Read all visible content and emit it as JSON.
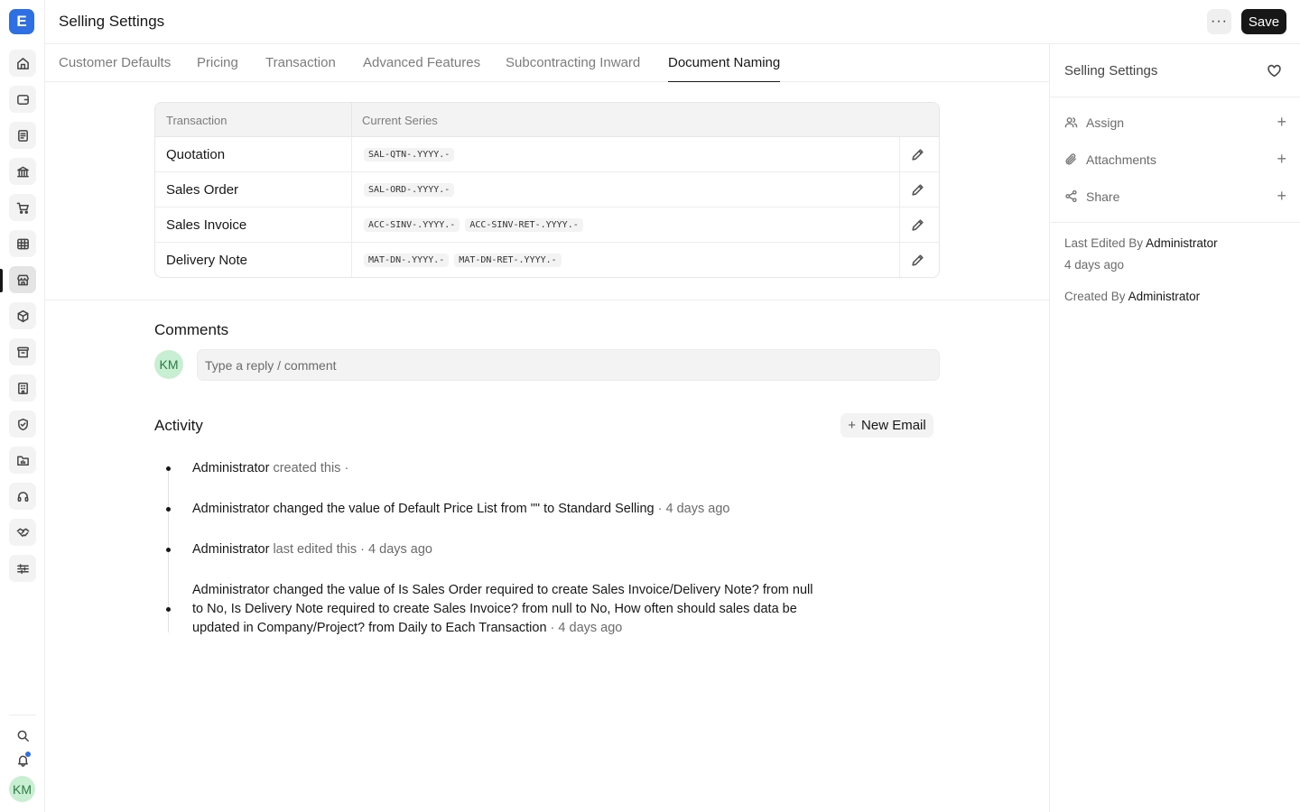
{
  "app": {
    "logo_letter": "E"
  },
  "header": {
    "title": "Selling Settings",
    "more_label": "···",
    "save_label": "Save"
  },
  "tabs": [
    {
      "label": "Customer Defaults"
    },
    {
      "label": "Pricing"
    },
    {
      "label": "Transaction"
    },
    {
      "label": "Advanced Features"
    },
    {
      "label": "Subcontracting Inward"
    },
    {
      "label": "Document Naming",
      "active": true
    }
  ],
  "naming_table": {
    "headers": [
      "Transaction",
      "Current Series"
    ],
    "rows": [
      {
        "transaction": "Quotation",
        "series": [
          "SAL-QTN-.YYYY.-"
        ]
      },
      {
        "transaction": "Sales Order",
        "series": [
          "SAL-ORD-.YYYY.-"
        ]
      },
      {
        "transaction": "Sales Invoice",
        "series": [
          "ACC-SINV-.YYYY.-",
          "ACC-SINV-RET-.YYYY.-"
        ]
      },
      {
        "transaction": "Delivery Note",
        "series": [
          "MAT-DN-.YYYY.-",
          "MAT-DN-RET-.YYYY.-"
        ]
      }
    ]
  },
  "comments": {
    "title": "Comments",
    "avatar_initials": "KM",
    "placeholder": "Type a reply / comment"
  },
  "activity": {
    "title": "Activity",
    "new_email_label": "New Email",
    "items": [
      {
        "actor": "Administrator",
        "text": "created this ·"
      },
      {
        "line": "Administrator changed the value of Default Price List from \"\" to ",
        "strong": "Standard Selling",
        "time": "· 4 days ago"
      },
      {
        "actor": "Administrator",
        "text": "last edited this · 4 days ago"
      },
      {
        "p1": "Administrator changed the value of Is Sales Order required to create Sales Invoice/Delivery Note? from ",
        "b1": "null",
        "p2": " to ",
        "b2": "No",
        "p3": ", Is Delivery Note required to create Sales Invoice? from ",
        "b3": "null",
        "p4": " to ",
        "b4": "No",
        "p5": ", How often should sales data be updated in Company/Project? from ",
        "b5": "Daily",
        "p6": " to ",
        "b6": "Each Transaction",
        "time": " · 4 days ago"
      }
    ]
  },
  "right_panel": {
    "title": "Selling Settings",
    "actions": [
      {
        "label": "Assign"
      },
      {
        "label": "Attachments"
      },
      {
        "label": "Share"
      }
    ],
    "last_edited_prefix": "Last Edited By",
    "last_edited_by": "Administrator",
    "last_edited_time": "4 days ago",
    "created_prefix": "Created By",
    "created_by": "Administrator"
  },
  "user": {
    "initials": "KM"
  },
  "colors": {
    "accent": "#2f6fe4",
    "primary_button": "#171717",
    "avatar_bg": "#c9efd3"
  }
}
